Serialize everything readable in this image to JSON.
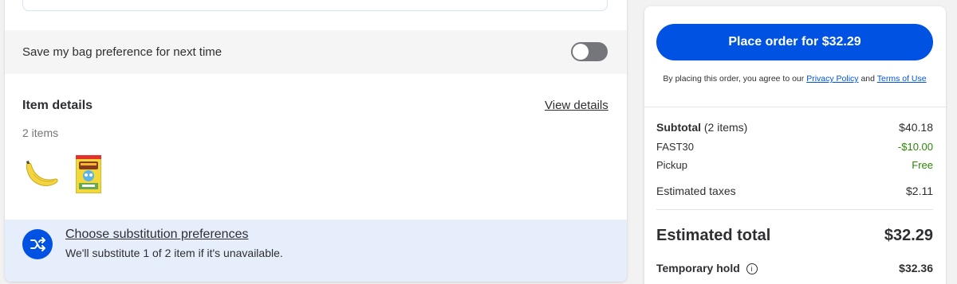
{
  "left": {
    "bag_preference_label": "Save my bag preference for next time",
    "item_details": {
      "title": "Item details",
      "view_link": "View details",
      "count": "2 items"
    },
    "substitution": {
      "title": "Choose substitution preferences",
      "subtitle": "We'll substitute 1 of 2 item if it's unavailable."
    }
  },
  "right": {
    "place_order_label": "Place order for $32.29",
    "agree_prefix": "By placing this order, you agree to our",
    "privacy_link": "Privacy Policy",
    "agree_and": "and",
    "terms_link": "Terms of Use",
    "summary": {
      "subtotal_label": "Subtotal",
      "subtotal_count": "(2 items)",
      "subtotal_value": "$40.18",
      "promo_label": "FAST30",
      "promo_value": "-$10.00",
      "pickup_label": "Pickup",
      "pickup_value": "Free",
      "taxes_label": "Estimated taxes",
      "taxes_value": "$2.11",
      "total_label": "Estimated total",
      "total_value": "$32.29",
      "hold_label": "Temporary hold",
      "hold_value": "$32.36"
    }
  },
  "colors": {
    "brand_blue": "#0053e2",
    "savings_green": "#2a8703"
  },
  "icons": {
    "info": "info-icon",
    "shuffle": "shuffle-icon"
  }
}
